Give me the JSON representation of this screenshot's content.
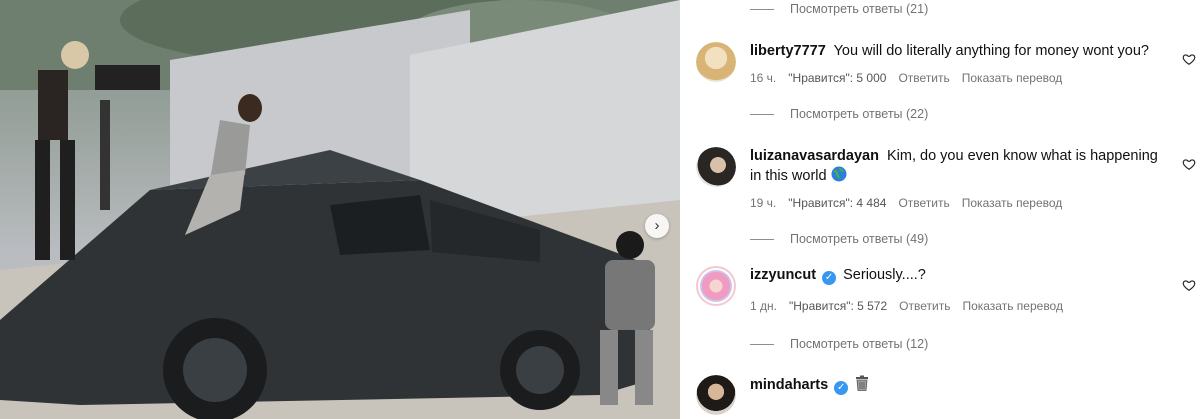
{
  "comments_panel": {
    "replies_top": "Посмотреть ответы (21)",
    "comments": [
      {
        "username": "liberty7777",
        "verified": false,
        "text": "You will do literally anything for money wont you?",
        "time": "16 ч.",
        "likes": "\"Нравится\": 5 000",
        "reply": "Ответить",
        "translate": "Показать перевод",
        "replies": "Посмотреть ответы (22)",
        "avatar_icon": "blonde-user-avatar"
      },
      {
        "username": "luizanavasardayan",
        "verified": false,
        "text_line1": "Kim, do you even know what is happening",
        "text_line2": "in this world",
        "emoji": "globe-emoji",
        "time": "19 ч.",
        "likes": "\"Нравится\": 4 484",
        "reply": "Ответить",
        "translate": "Показать перевод",
        "replies": "Посмотреть ответы (49)",
        "avatar_icon": "dark-hair-user-avatar"
      },
      {
        "username": "izzyuncut",
        "verified": true,
        "text": "Seriously....?",
        "time": "1 дн.",
        "likes": "\"Нравится\": 5 572",
        "reply": "Ответить",
        "translate": "Показать перевод",
        "replies": "Посмотреть ответы (12)",
        "avatar_icon": "pink-hair-user-avatar"
      },
      {
        "username": "mindaharts",
        "verified": true,
        "emoji": "trash-can-emoji",
        "avatar_icon": "woman-user-avatar"
      }
    ]
  },
  "colors": {
    "secondary_text": "#737373",
    "verified_blue": "#3897f0",
    "story_ring": "#f4c7d3"
  },
  "icons": [
    "heart-icon",
    "chevron-right-icon",
    "verified-badge-icon"
  ]
}
